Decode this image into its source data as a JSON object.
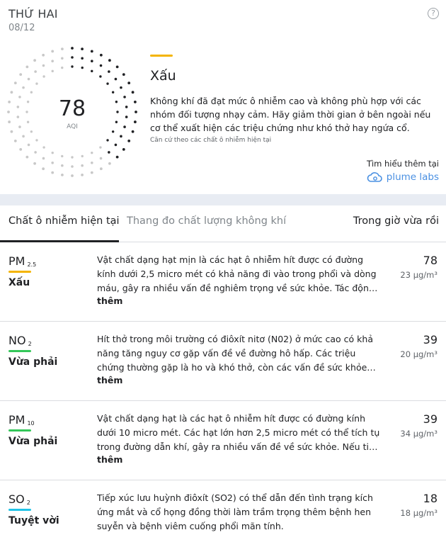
{
  "header": {
    "day": "THỨ HAI",
    "date": "08/12",
    "help_symbol": "?"
  },
  "aqi": {
    "value": "78",
    "label": "AQI",
    "level": "Xấu",
    "level_color": "#f4b400",
    "level_fraction": 0.39,
    "description": "Không khí đã đạt mức ô nhiễm cao và không phù hợp với các nhóm đối tượng nhạy cảm. Hãy giảm thời gian ở bên ngoài nếu cơ thể xuất hiện các triệu chứng như khó thở hay ngứa cổ.",
    "note": "Căn cứ theo các chất ô nhiễm hiện tại"
  },
  "source": {
    "learn_more": "Tìm hiểu thêm tại",
    "brand": "plume labs",
    "brand_color": "#4a90e2"
  },
  "tabs": [
    {
      "label": "Chất ô nhiễm hiện tại"
    },
    {
      "label": "Thang đo chất lượng không khí"
    },
    {
      "label": "Trong giờ vừa rồi"
    }
  ],
  "pollutants": [
    {
      "name": "PM",
      "sub": "2.5",
      "level": "Xấu",
      "color": "#f4b400",
      "desc": "Vật chất dạng hạt mịn là các hạt ô nhiễm hít được có đường kính dưới 2,5 micro mét có khả năng đi vào trong phổi và dòng máu, gây ra nhiều vấn đề nghiêm trọng về sức khỏe. Tác động đến tim, phổi và não.",
      "more": "thêm",
      "value": "78",
      "conc": "23 µg/m³"
    },
    {
      "name": "NO",
      "sub": "2",
      "level": "Vừa phải",
      "color": "#34c759",
      "desc": "Hít thở trong môi trường có điôxít nitơ (N02) ở mức cao có khả năng tăng nguy cơ gặp vấn đề về đường hô hấp. Các triệu chứng thường gặp là ho và khó thở, còn các vấn đề sức khỏe nghiêm trọng hơn nữa.",
      "more": "thêm",
      "value": "39",
      "conc": "20 µg/m³"
    },
    {
      "name": "PM",
      "sub": "10",
      "level": "Vừa phải",
      "color": "#34c759",
      "desc": "Vật chất dạng hạt là các hạt ô nhiễm hít được có đường kính dưới 10 micro mét. Các hạt lớn hơn 2,5 micro mét có thể tích tụ trong đường dẫn khí, gây ra nhiều vấn đề về sức khỏe. Nếu tiếp xúc lâu dài.",
      "more": "thêm",
      "value": "39",
      "conc": "34 µg/m³"
    },
    {
      "name": "SO",
      "sub": "2",
      "level": "Tuyệt vời",
      "color": "#20c4e8",
      "desc": "Tiếp xúc lưu huỳnh điôxít (SO2) có thể dẫn đến tình trạng kích ứng mắt và cổ họng đồng thời làm trầm trọng thêm bệnh hen suyễn và bệnh viêm cuống phổi mãn tính.",
      "more": "",
      "value": "18",
      "conc": "18 µg/m³"
    }
  ]
}
